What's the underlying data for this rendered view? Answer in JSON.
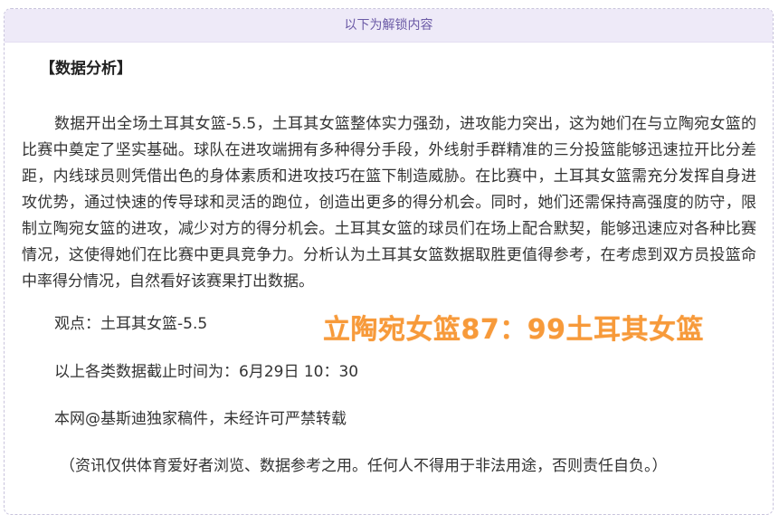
{
  "header": {
    "unlock_label": "以下为解锁内容"
  },
  "article": {
    "section_title": "【数据分析】",
    "body": "数据开出全场土耳其女篮-5.5，土耳其女篮整体实力强劲，进攻能力突出，这为她们在与立陶宛女篮的比赛中奠定了坚实基础。球队在进攻端拥有多种得分手段，外线射手群精准的三分投篮能够迅速拉开比分差距，内线球员则凭借出色的身体素质和进攻技巧在篮下制造威胁。在比赛中，土耳其女篮需充分发挥自身进攻优势，通过快速的传导球和灵活的跑位，创造出更多的得分机会。同时，她们还需保持高强度的防守，限制立陶宛女篮的进攻，减少对方的得分机会。土耳其女篮的球员们在场上配合默契，能够迅速应对各种比赛情况，这使得她们在比赛中更具竞争力。分析认为土耳其女篮数据取胜更值得参考，在考虑到双方员投篮命中率得分情况，自然看好该赛果打出数据。",
    "viewpoint": "观点：土耳其女篮-5.5",
    "cutoff_time": "以上各类数据截止时间为：6月29日 10：30",
    "copyright": "本网@基斯迪独家稿件，未经许可严禁转载",
    "disclaimer": "（资讯仅供体育爱好者浏览、数据参考之用。任何人不得用于非法用途，否则责任自负。）"
  },
  "score_overlay": {
    "text": "立陶宛女篮87：99土耳其女篮",
    "color": "#f79a3a"
  }
}
